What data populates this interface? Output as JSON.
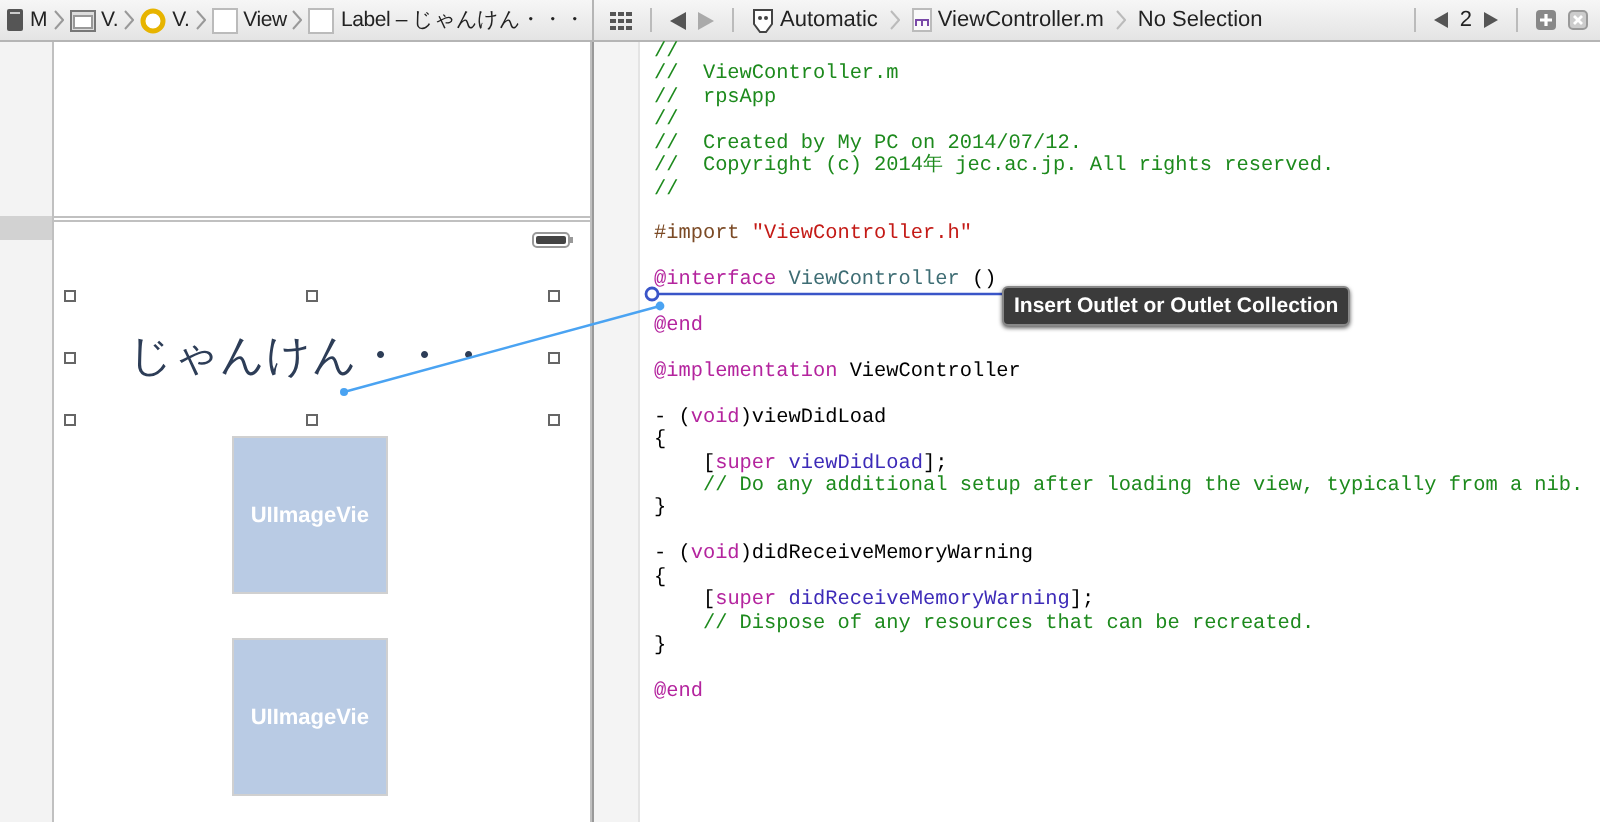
{
  "jump_bar_left": {
    "crumbs": [
      {
        "label": "M",
        "kind": "document"
      },
      {
        "label": "V.",
        "kind": "scene"
      },
      {
        "label": "V.",
        "kind": "controller"
      },
      {
        "label": "View",
        "kind": "view"
      },
      {
        "label": "Label – じゃんけん・・・",
        "kind": "view"
      }
    ]
  },
  "jump_bar_right": {
    "crumbs": [
      {
        "label": "Automatic",
        "kind": "assistant"
      },
      {
        "label": "ViewController.m",
        "kind": "source"
      },
      {
        "label": "No Selection",
        "kind": "plain"
      }
    ],
    "counter": "2"
  },
  "canvas": {
    "label": "じゃんけん・・・",
    "image_views": [
      "UIImageVie",
      "UIImageVie"
    ]
  },
  "connection_tooltip": "Insert Outlet or Outlet Collection",
  "code_lines": [
    {
      "segments": [
        {
          "text": "//",
          "kind": "comment"
        }
      ]
    },
    {
      "segments": [
        {
          "text": "//  ViewController.m",
          "kind": "comment"
        }
      ]
    },
    {
      "segments": [
        {
          "text": "//  rpsApp",
          "kind": "comment"
        }
      ]
    },
    {
      "segments": [
        {
          "text": "//",
          "kind": "comment"
        }
      ]
    },
    {
      "segments": [
        {
          "text": "//  Created by My PC on 2014/07/12.",
          "kind": "comment"
        }
      ]
    },
    {
      "segments": [
        {
          "text": "//  Copyright (c) 2014年 jec.ac.jp. All rights reserved.",
          "kind": "comment"
        }
      ]
    },
    {
      "segments": [
        {
          "text": "//",
          "kind": "comment"
        }
      ]
    },
    {
      "blank_before": true,
      "segments": [
        {
          "text": "#import ",
          "kind": "preprocessor"
        },
        {
          "text": "\"ViewController.h\"",
          "kind": "string"
        }
      ]
    },
    {
      "blank_before": true,
      "segments": [
        {
          "text": "@interface ",
          "kind": "keyword"
        },
        {
          "text": "ViewController",
          "kind": "class"
        },
        {
          "text": " ()",
          "kind": "plain"
        }
      ]
    },
    {
      "blank_before": true,
      "segments": [
        {
          "text": "@end",
          "kind": "keyword"
        }
      ]
    },
    {
      "blank_before": true,
      "segments": [
        {
          "text": "@implementation",
          "kind": "keyword"
        },
        {
          "text": " ViewController",
          "kind": "plain"
        }
      ]
    },
    {
      "blank_before": true,
      "segments": [
        {
          "text": "- (",
          "kind": "plain"
        },
        {
          "text": "void",
          "kind": "keyword"
        },
        {
          "text": ")viewDidLoad",
          "kind": "plain"
        }
      ]
    },
    {
      "segments": [
        {
          "text": "{",
          "kind": "plain"
        }
      ]
    },
    {
      "segments": [
        {
          "text": "    [",
          "kind": "plain"
        },
        {
          "text": "super ",
          "kind": "keyword"
        },
        {
          "text": "viewDidLoad",
          "kind": "method"
        },
        {
          "text": "];",
          "kind": "plain"
        }
      ]
    },
    {
      "segments": [
        {
          "text": "    // Do any additional setup after loading the view, typically from a nib.",
          "kind": "comment"
        }
      ]
    },
    {
      "segments": [
        {
          "text": "}",
          "kind": "plain"
        }
      ]
    },
    {
      "blank_before": true,
      "segments": [
        {
          "text": "- (",
          "kind": "plain"
        },
        {
          "text": "void",
          "kind": "keyword"
        },
        {
          "text": ")didReceiveMemoryWarning",
          "kind": "plain"
        }
      ]
    },
    {
      "segments": [
        {
          "text": "{",
          "kind": "plain"
        }
      ]
    },
    {
      "segments": [
        {
          "text": "    [",
          "kind": "plain"
        },
        {
          "text": "super ",
          "kind": "keyword"
        },
        {
          "text": "didReceiveMemoryWarning",
          "kind": "method"
        },
        {
          "text": "];",
          "kind": "plain"
        }
      ]
    },
    {
      "segments": [
        {
          "text": "    // Dispose of any resources that can be recreated.",
          "kind": "comment"
        }
      ]
    },
    {
      "segments": [
        {
          "text": "}",
          "kind": "plain"
        }
      ]
    },
    {
      "blank_before": true,
      "segments": [
        {
          "text": "@end",
          "kind": "keyword"
        }
      ]
    }
  ]
}
